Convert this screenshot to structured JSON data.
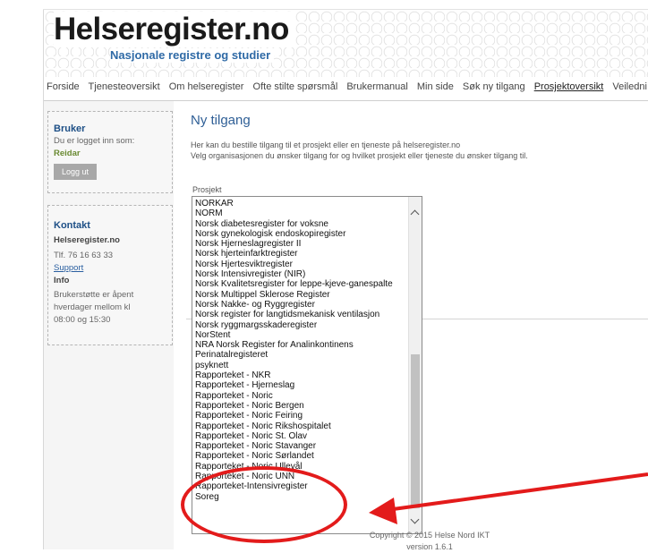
{
  "header": {
    "logo": "Helseregister.no",
    "tagline": "Nasjonale registre og studier"
  },
  "nav": {
    "items": [
      "Forside",
      "Tjenesteoversikt",
      "Om helseregister",
      "Ofte stilte spørsmål",
      "Brukermanual",
      "Min side",
      "Søk ny tilgang",
      "Prosjektoversikt",
      "Veiledni"
    ]
  },
  "sidebar": {
    "user": {
      "title": "Bruker",
      "logged_in_text": "Du er logget inn som:",
      "username": "Reidar",
      "logout_label": "Logg ut"
    },
    "contact": {
      "title": "Kontakt",
      "org": "Helseregister.no",
      "phone": "Tlf. 76 16 63 33",
      "support_link": "Support",
      "info_label": "Info",
      "info_text_1": "Brukerstøtte er åpent",
      "info_text_2": "hverdager mellom kl",
      "info_text_3": "08:00 og 15:30"
    }
  },
  "main": {
    "title": "Ny tilgang",
    "desc_1": "Her kan du bestille tilgang til et prosjekt eller en tjeneste på helseregister.no",
    "desc_2": "Velg organisasjonen du ønsker tilgang for og hvilket prosjekt eller tjeneste du ønsker tilgang til.",
    "project_label": "Prosjekt",
    "project_options": [
      "NORKAR",
      "NORM",
      "Norsk diabetesregister for voksne",
      "Norsk gynekologisk endoskopiregister",
      "Norsk Hjerneslagregister II",
      "Norsk hjerteinfarktregister",
      "Norsk Hjertesviktregister",
      "Norsk Intensivregister (NIR)",
      "Norsk Kvalitetsregister for leppe-kjeve-ganespalte",
      "Norsk Multippel Sklerose Register",
      "Norsk Nakke- og Ryggregister",
      "Norsk register for langtidsmekanisk ventilasjon",
      "Norsk ryggmargsskaderegister",
      "NorStent",
      "NRA Norsk Register for Analinkontinens",
      "Perinatalregisteret",
      "psyknett",
      "Rapporteket - NKR",
      "Rapporteket - Hjerneslag",
      "Rapporteket - Noric",
      "Rapporteket - Noric Bergen",
      "Rapporteket - Noric Feiring",
      "Rapporteket - Noric Rikshospitalet",
      "Rapporteket - Noric St. Olav",
      "Rapporteket - Noric Stavanger",
      "Rapporteket - Noric Sørlandet",
      "Rapporteket - Noric Ullevål",
      "Rapporteket - Noric UNN",
      "Rapporteket-Intensivregister",
      "Soreg"
    ]
  },
  "footer": {
    "copyright": "Copyright © 2015 Helse Nord IKT",
    "version": "version 1.6.1"
  },
  "colors": {
    "annotation": "#e31b1b",
    "link": "#2a5fa0",
    "title": "#2f5f96"
  }
}
